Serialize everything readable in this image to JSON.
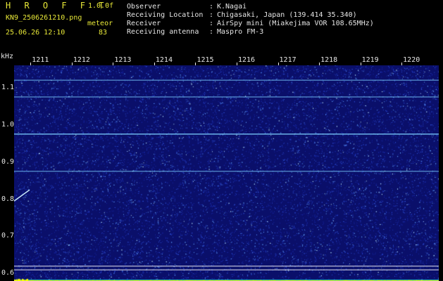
{
  "app": {
    "title": "H R O F F T",
    "version": "1.0.0f",
    "filename": "KN9_2506261210.png",
    "datetime": "25.06.26 12:10",
    "meteor_label": "meteor",
    "meteor_count": "83"
  },
  "info": {
    "rows": [
      {
        "label": "Observer",
        "value": "K.Nagai"
      },
      {
        "label": "Receiving Location",
        "value": "Chigasaki, Japan (139.414 35.340)"
      },
      {
        "label": "Receiver",
        "value": "AirSpy mini (Miakejima VOR 108.65MHz)"
      },
      {
        "label": "Receiving antenna",
        "value": "Maspro FM-3"
      }
    ]
  },
  "chart_data": {
    "type": "heatmap",
    "xlabel": "",
    "ylabel": "kHz",
    "x_ticks": [
      "1211",
      "1212",
      "1213",
      "1214",
      "1215",
      "1216",
      "1217",
      "1218",
      "1219",
      "1220"
    ],
    "y_ticks": [
      "1.1",
      "1.0",
      "0.9",
      "0.8",
      "0.7",
      "0.6"
    ],
    "x_range": [
      1210.5,
      1220.8
    ],
    "y_range": [
      0.58,
      1.16
    ],
    "horizontal_lines_khz": [
      1.12,
      1.075,
      0.975,
      0.875,
      0.62,
      0.61
    ],
    "colors": {
      "background": "#0a0f6a",
      "line": "#7cd0ff",
      "floor": "#00e5ff",
      "peak": "#ffff00"
    }
  }
}
